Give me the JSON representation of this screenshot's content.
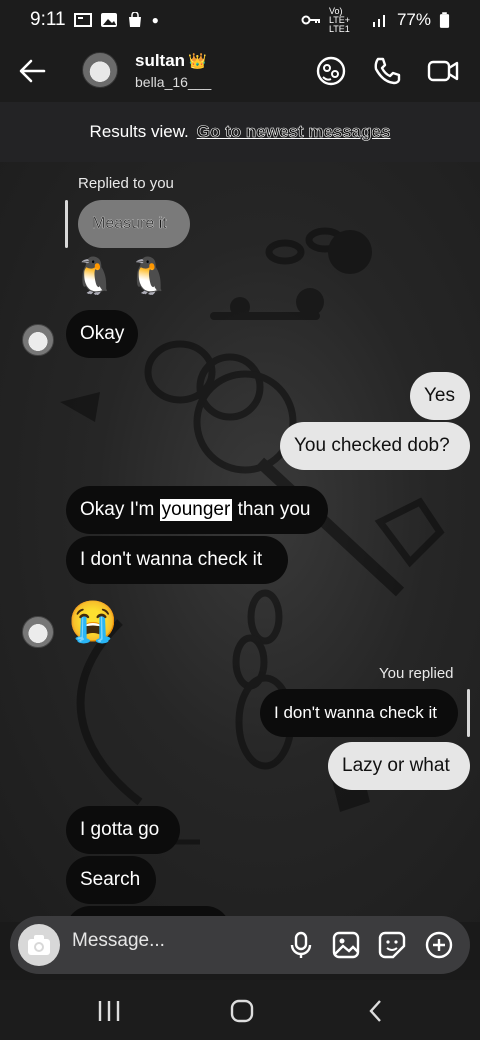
{
  "status_bar": {
    "time": "9:11",
    "network": "Vo) LTE+ LTE1",
    "battery": "77%"
  },
  "header": {
    "name": "sultan",
    "name_badge": "👑",
    "handle": "bella_16___",
    "icons": [
      "back-arrow-icon",
      "sticker-effect-icon",
      "phone-icon",
      "video-icon"
    ]
  },
  "results_bar": {
    "label": "Results view.",
    "link": "Go to newest messages"
  },
  "messages": {
    "replied_to_you": "Replied to you",
    "quote_measure": "Measure it",
    "penguins": "🐧 🐧",
    "okay": "Okay",
    "yes": "Yes",
    "checked_dob": "You checked dob?",
    "younger_pre": "Okay I'm ",
    "younger_hl": "younger",
    "younger_post": " than you",
    "dont_wanna_1": "I don't wanna check it",
    "crying": "😭",
    "you_replied": "You replied",
    "quote_dont_wanna": "I don't wanna check it",
    "lazy": "Lazy or what",
    "gotta_go": "I gotta go",
    "search": "Search"
  },
  "composer": {
    "placeholder": "Message..."
  },
  "colors": {
    "sent_bubble": "#e6e6e6",
    "received_bubble": "#0c0c0c",
    "composer_bg": "#3c3c3e"
  }
}
